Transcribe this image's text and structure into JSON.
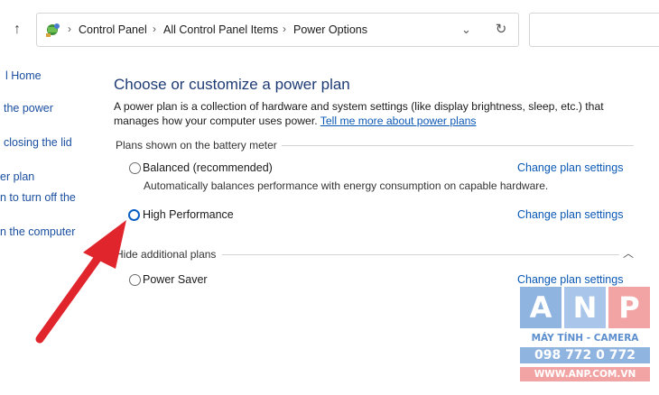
{
  "address_bar": {
    "breadcrumbs": [
      "Control Panel",
      "All Control Panel Items",
      "Power Options"
    ],
    "icon": "control-panel-icon"
  },
  "left_nav": {
    "items": [
      "l Home",
      "the power",
      "closing the lid",
      "er plan",
      "n to turn off the",
      "n the computer"
    ]
  },
  "main": {
    "title": "Choose or customize a power plan",
    "description": "A power plan is a collection of hardware and system settings (like display brightness, sleep, etc.) that manages how your computer uses power.",
    "learn_more_link": "Tell me more about power plans",
    "battery_group_label": "Plans shown on the battery meter",
    "plans": [
      {
        "name": "Balanced (recommended)",
        "selected": false,
        "description": "Automatically balances performance with energy consumption on capable hardware.",
        "link": "Change plan settings"
      },
      {
        "name": "High Performance",
        "selected": true,
        "description": "",
        "link": "Change plan settings"
      }
    ],
    "additional_group_label": "Hide additional plans",
    "additional_plans": [
      {
        "name": "Power Saver",
        "selected": false,
        "link": "Change plan settings"
      }
    ]
  },
  "watermark": {
    "letters": [
      "A",
      "N",
      "P"
    ],
    "line1": "MÁY TÍNH - CAMERA",
    "line2": "098 772 0 772",
    "line3": "WWW.ANP.COM.VN"
  },
  "colors": {
    "accent": "#0a5fc2",
    "title": "#1e3b74",
    "link": "#0a58b5",
    "annotation_arrow": "#e0252d"
  }
}
